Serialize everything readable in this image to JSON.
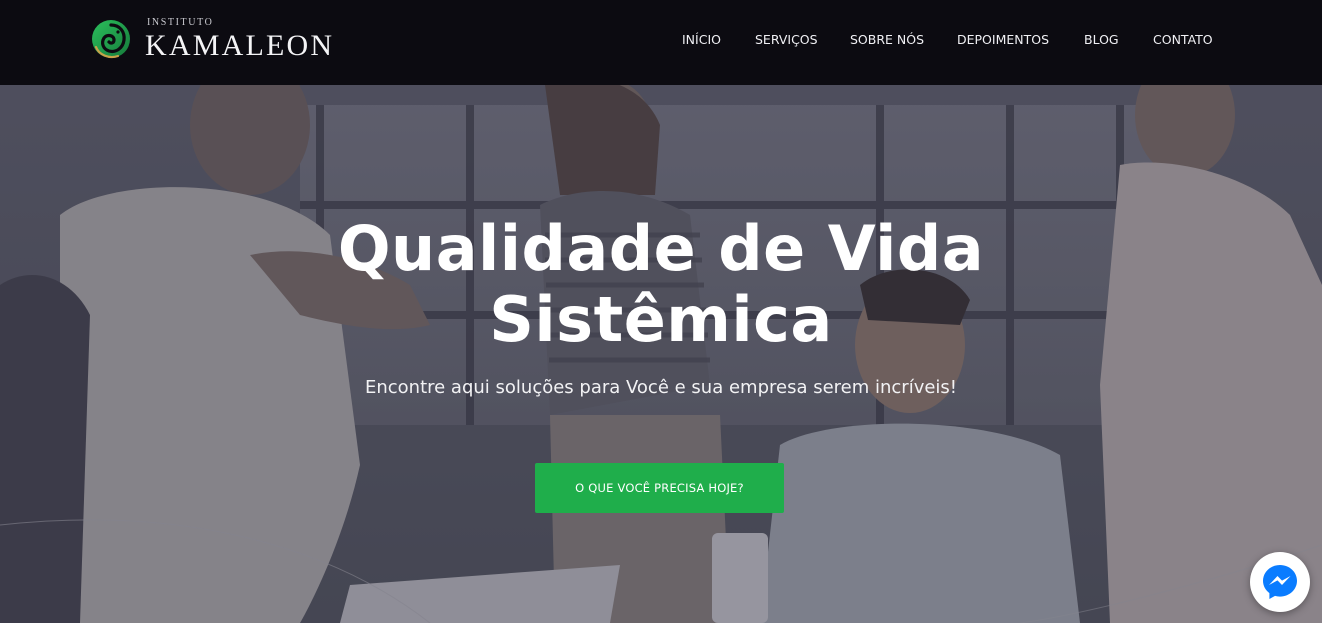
{
  "brand": {
    "small_text": "INSTITUTO",
    "name": "KAMALEON",
    "logo_icon": "chameleon-logo-icon",
    "colors": {
      "green": "#21a152",
      "gold": "#c8a24a"
    }
  },
  "nav": {
    "items": [
      {
        "label": "INÍCIO"
      },
      {
        "label": "SERVIÇOS"
      },
      {
        "label": "SOBRE NÓS"
      },
      {
        "label": "DEPOIMENTOS"
      },
      {
        "label": "BLOG"
      },
      {
        "label": "CONTATO"
      }
    ]
  },
  "hero": {
    "title_line1": "Qualidade de Vida",
    "title_line2": "Sistêmica",
    "subtitle": "Encontre aqui soluções para Você e sua empresa serem incríveis!",
    "cta_label": "O QUE VOCÊ PRECISA HOJE?",
    "cta_color": "#1fae4b"
  },
  "chat": {
    "icon": "messenger-icon",
    "color": "#0a7cff"
  }
}
